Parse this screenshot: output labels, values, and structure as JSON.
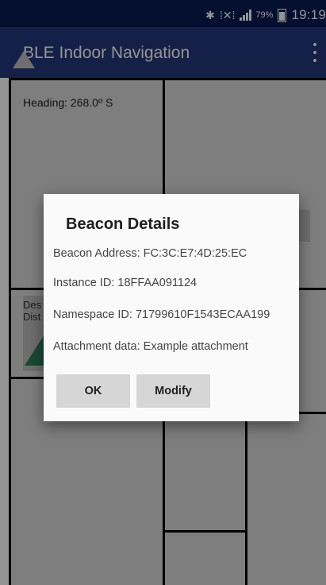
{
  "status_bar": {
    "time": "19:19",
    "battery": "79%",
    "bluetooth_icon": "bluetooth-icon",
    "mute_icon": "vibrate-mute-icon",
    "signal_icon": "signal-strength-icon"
  },
  "app_bar": {
    "title": "BLE Indoor Navigation",
    "menu_icon": "overflow-menu-icon"
  },
  "map": {
    "heading": "Heading: 268.0º S",
    "destination_label": "Des",
    "distance_label": "Dist",
    "direction_icon": "direction-arrow-icon"
  },
  "dialog": {
    "title": "Beacon Details",
    "beacon_address": "Beacon Address: FC:3C:E7:4D:25:EC",
    "instance_id": "Instance ID: 18FFAA091124",
    "namespace_id": "Namespace ID: 71799610F1543ECAA199",
    "attachment": "Attachment data: Example attachment",
    "ok_label": "OK",
    "modify_label": "Modify"
  },
  "colors": {
    "status_bar": "#0a1a52",
    "app_bar": "#23377b",
    "dialog_background": "#fafafa",
    "dialog_button": "#d6d6d6",
    "arrow": "#2e7d5b"
  }
}
